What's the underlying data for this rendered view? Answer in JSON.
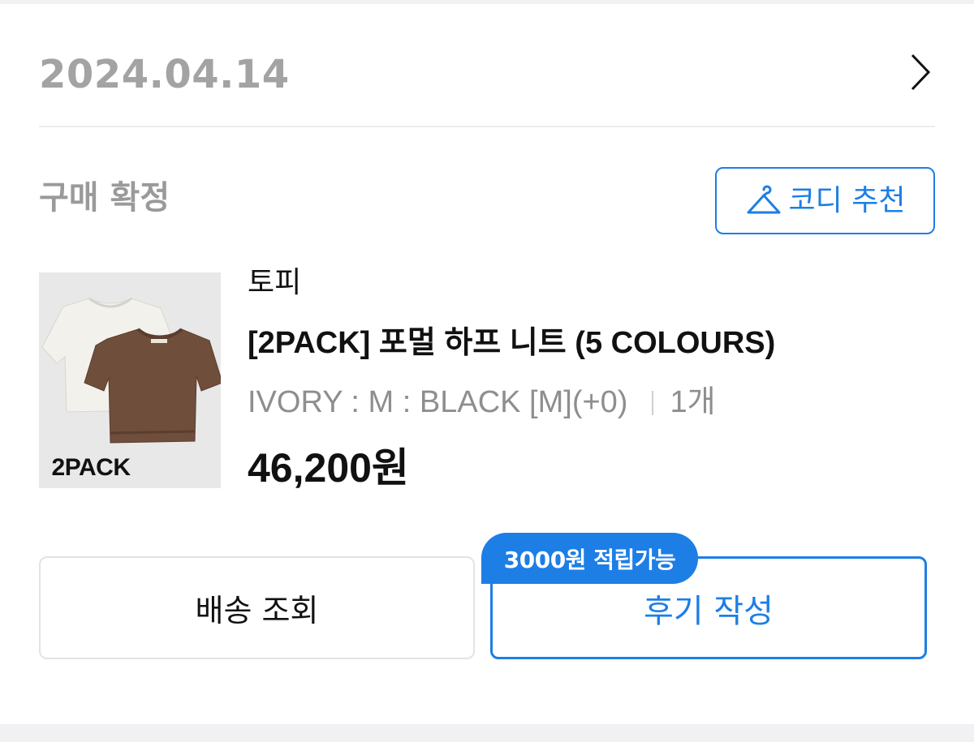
{
  "order": {
    "date": "2024.04.14",
    "status": "구매 확정"
  },
  "codi_button": {
    "label": "코디 추천",
    "icon": "hanger-icon"
  },
  "product": {
    "brand": "토피",
    "name": "[2PACK] 포멀 하프 니트 (5 COLOURS)",
    "option": "IVORY : M : BLACK [M](+0)",
    "quantity": "1개",
    "price": "46,200원",
    "thumbnail_text": "2PACK"
  },
  "actions": {
    "track_label": "배송 조회",
    "review_label": "후기 작성",
    "review_badge": "3000원 적립가능"
  },
  "colors": {
    "accent": "#1d7ee6",
    "muted_text": "#9a9a9a"
  }
}
